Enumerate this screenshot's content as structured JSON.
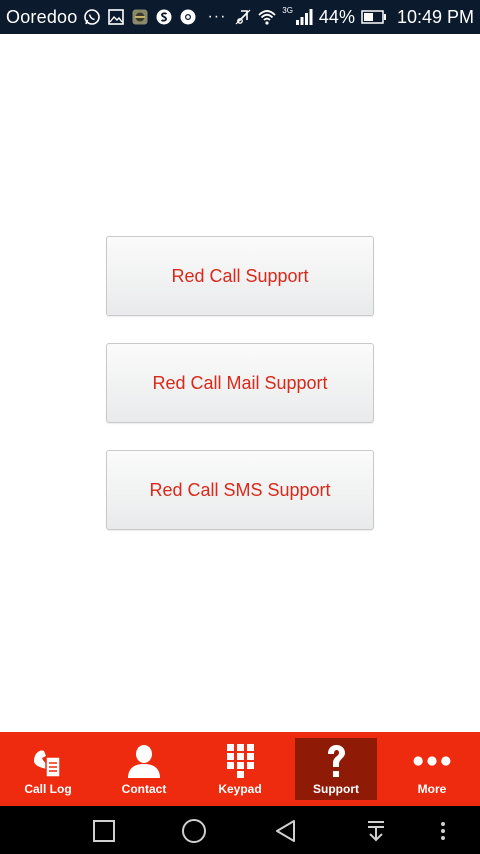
{
  "status_bar": {
    "carrier": "Ooredoo",
    "network_type": "3G",
    "battery_percent": "44%",
    "time": "10:49 PM",
    "overflow": "···",
    "left_icons": [
      "whatsapp-icon",
      "gallery-icon",
      "app-icon",
      "skype-icon",
      "chrome-icon"
    ],
    "right_icons": [
      "mute-icon",
      "wifi-icon",
      "signal-icon",
      "battery-icon"
    ]
  },
  "support_buttons": [
    {
      "label": "Red Call Support"
    },
    {
      "label": "Red Call Mail Support"
    },
    {
      "label": "Red Call SMS Support"
    }
  ],
  "tabs": [
    {
      "label": "Call Log",
      "icon": "call-log-icon",
      "active": false
    },
    {
      "label": "Contact",
      "icon": "contact-icon",
      "active": false
    },
    {
      "label": "Keypad",
      "icon": "keypad-icon",
      "active": false
    },
    {
      "label": "Support",
      "icon": "support-icon",
      "active": true
    },
    {
      "label": "More",
      "icon": "more-icon",
      "active": false
    }
  ],
  "nav_bar": {
    "buttons": [
      "recents-icon",
      "home-icon",
      "back-icon",
      "notification-pull-icon",
      "menu-icon"
    ]
  },
  "colors": {
    "status_bar_bg": "#0c1a2e",
    "tab_bar_bg": "#ee2a0f",
    "tab_active_bg": "#8f1a06",
    "button_text": "#d9291b",
    "nav_bar_bg": "#000000"
  }
}
